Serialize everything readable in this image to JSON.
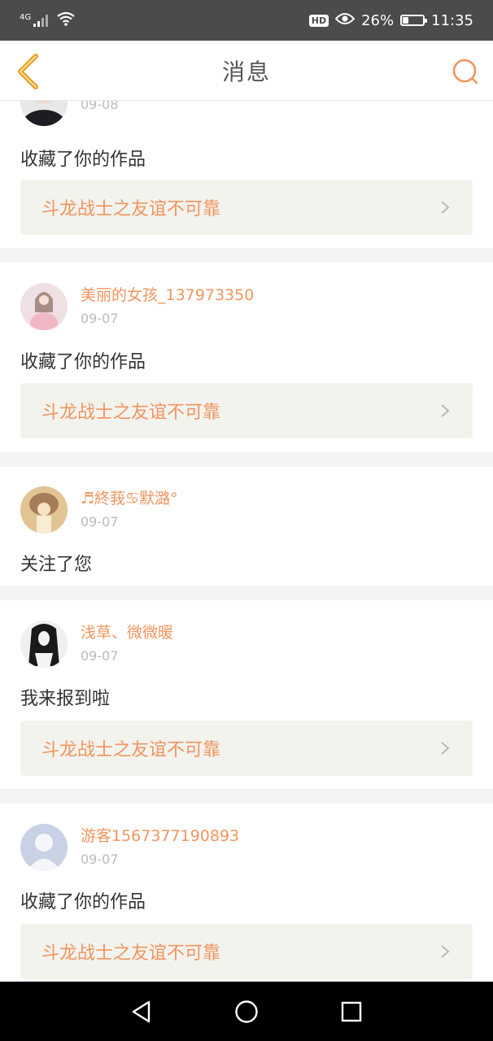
{
  "status_bar": {
    "network": "4G",
    "battery_percent": "26%",
    "battery_level": 0.26,
    "time": "11:35",
    "hd_label": "HD"
  },
  "header": {
    "title": "消息",
    "back_icon": "chevron-left-icon",
    "search_icon": "search-icon"
  },
  "colors": {
    "accent": "#f0955f",
    "back_arrow": "#e8a020",
    "status_bg": "#4b4b4b"
  },
  "messages": [
    {
      "date": "09-08",
      "action": "收藏了你的作品",
      "work_title": "斗龙战士之友谊不可靠"
    },
    {
      "user": "美丽的女孩_137973350",
      "date": "09-07",
      "action": "收藏了你的作品",
      "work_title": "斗龙战士之友谊不可靠"
    },
    {
      "user": "♬終莪♋默潞°",
      "date": "09-07",
      "action": "关注了您"
    },
    {
      "user": "浅草、微微暖",
      "date": "09-07",
      "action": "我来报到啦",
      "work_title": "斗龙战士之友谊不可靠"
    },
    {
      "user": "游客1567377190893",
      "date": "09-07",
      "action": "收藏了你的作品",
      "work_title": "斗龙战士之友谊不可靠"
    }
  ],
  "nav": {
    "back": "nav-back-icon",
    "home": "nav-home-icon",
    "recents": "nav-recents-icon"
  }
}
